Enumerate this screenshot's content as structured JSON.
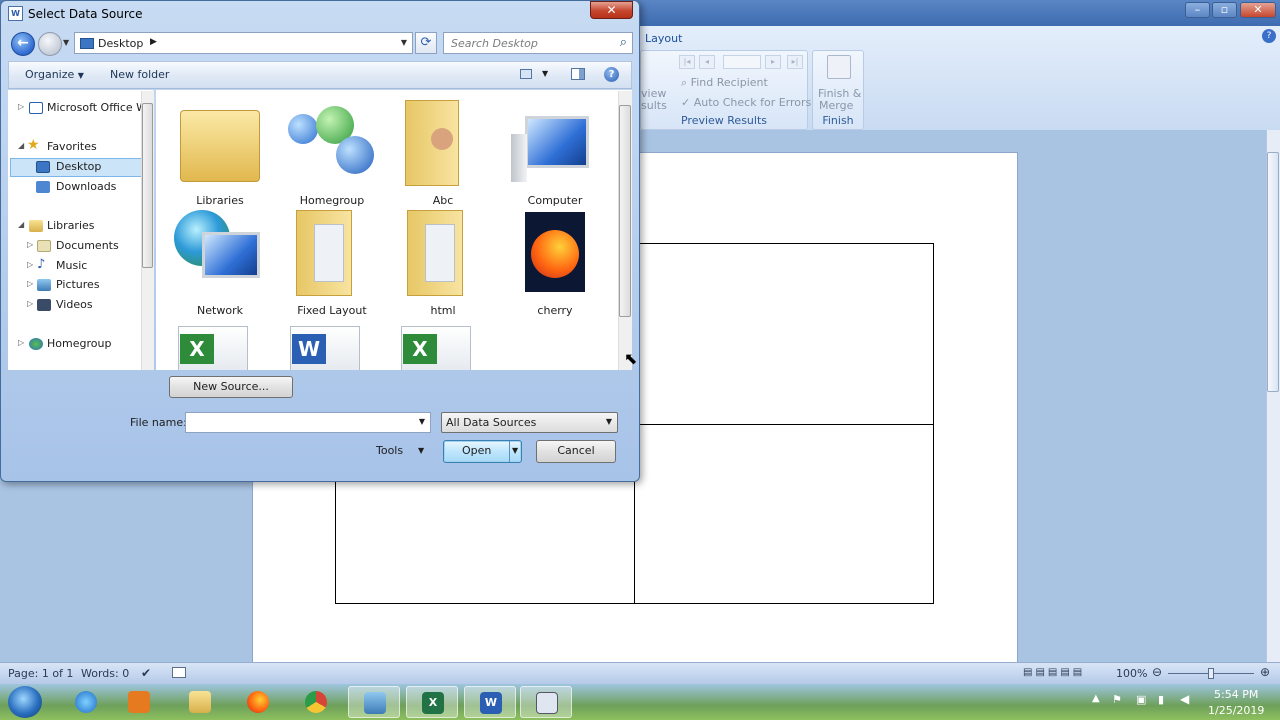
{
  "word": {
    "tab_layout": "Layout",
    "groups": {
      "preview_results": {
        "label": "Preview Results",
        "preview_label_1": "view",
        "preview_label_2": "sults",
        "find_recipient": "Find Recipient",
        "auto_check": "Auto Check for Errors"
      },
      "finish": {
        "label": "Finish",
        "finish_merge_1": "Finish &",
        "finish_merge_2": "Merge"
      }
    },
    "status": {
      "page": "Page: 1 of 1",
      "words": "Words: 0",
      "zoom": "100%"
    }
  },
  "dialog": {
    "title": "Select Data Source",
    "address": {
      "location": "Desktop"
    },
    "search_placeholder": "Search Desktop",
    "commands": {
      "organize": "Organize",
      "new_folder": "New folder"
    },
    "nav": {
      "items": [
        {
          "label": "Microsoft Office W"
        },
        {
          "label": "Favorites"
        },
        {
          "label": "Desktop"
        },
        {
          "label": "Downloads"
        },
        {
          "label": "Libraries"
        },
        {
          "label": "Documents"
        },
        {
          "label": "Music"
        },
        {
          "label": "Pictures"
        },
        {
          "label": "Videos"
        },
        {
          "label": "Homegroup"
        }
      ]
    },
    "files": [
      {
        "name": "Libraries"
      },
      {
        "name": "Homegroup"
      },
      {
        "name": "Abc"
      },
      {
        "name": "Computer"
      },
      {
        "name": "Network"
      },
      {
        "name": "Fixed Layout"
      },
      {
        "name": "html"
      },
      {
        "name": "cherry"
      }
    ],
    "new_source": "New Source...",
    "file_name_label": "File name:",
    "file_name_value": "",
    "filter": "All Data Sources",
    "tools": "Tools",
    "open": "Open",
    "cancel": "Cancel"
  },
  "taskbar": {
    "time": "5:54 PM",
    "date": "1/25/2019"
  }
}
